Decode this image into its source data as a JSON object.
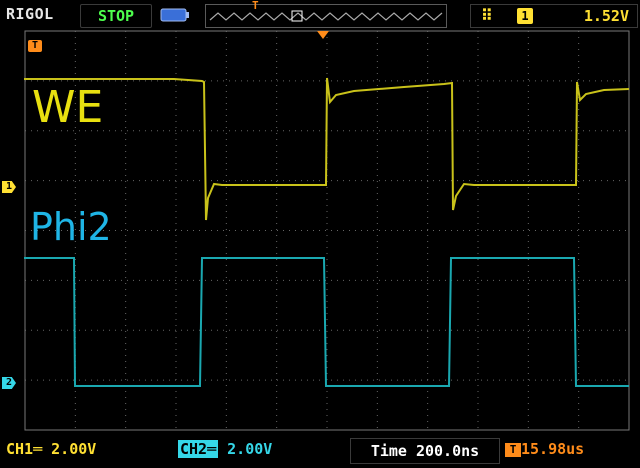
{
  "header": {
    "brand": "RIGOL",
    "run_state": "STOP",
    "trigger_source": "1",
    "trigger_level": "1.52V",
    "trigger_edge_icon": "rising-edge-icon",
    "memory_trigger_marker": "T"
  },
  "markers": {
    "trigger_marker": "T",
    "ch1_marker": "1",
    "ch2_marker": "2"
  },
  "labels": {
    "channel1": "WE",
    "channel2": "Phi2"
  },
  "footer": {
    "ch1_label": "CH1",
    "ch1_coupling_icon": "dc-coupling-icon",
    "ch1_scale": "2.00V",
    "ch2_label": "CH2",
    "ch2_coupling_icon": "dc-coupling-icon",
    "ch2_scale": "2.00V",
    "time_label": "Time",
    "time_scale": "200.0ns",
    "trigger_offset_tag": "T",
    "trigger_offset": "15.98us"
  },
  "colors": {
    "ch1": "#c9c21a",
    "ch2": "#1aa8b0",
    "trigger": "#ff8c1a",
    "grid": "#666666",
    "run_state": "#4dff4d"
  }
}
